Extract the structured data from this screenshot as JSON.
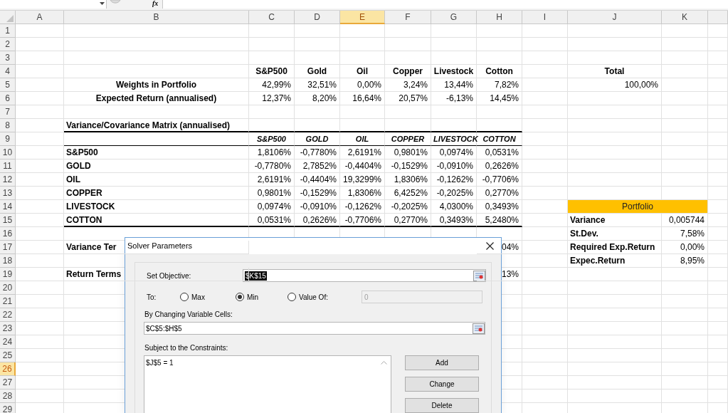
{
  "formula_bar": {
    "fx_label": "fx"
  },
  "columns": [
    {
      "label": "A",
      "selected": false
    },
    {
      "label": "B",
      "selected": false
    },
    {
      "label": "C",
      "selected": false
    },
    {
      "label": "D",
      "selected": false
    },
    {
      "label": "E",
      "selected": true
    },
    {
      "label": "F",
      "selected": false
    },
    {
      "label": "G",
      "selected": false
    },
    {
      "label": "H",
      "selected": false
    },
    {
      "label": "I",
      "selected": false
    },
    {
      "label": "J",
      "selected": false
    },
    {
      "label": "K",
      "selected": false
    }
  ],
  "rows": [
    {
      "label": "1",
      "selected": false
    },
    {
      "label": "2",
      "selected": false
    },
    {
      "label": "3",
      "selected": false
    },
    {
      "label": "4",
      "selected": false,
      "cells": {
        "C": {
          "text": "S&P500",
          "kind": "heading"
        },
        "D": {
          "text": "Gold",
          "kind": "heading"
        },
        "E": {
          "text": "Oil",
          "kind": "heading"
        },
        "F": {
          "text": "Copper",
          "kind": "heading"
        },
        "G": {
          "text": "Livestock",
          "kind": "heading"
        },
        "H": {
          "text": "Cotton",
          "kind": "heading"
        },
        "J": {
          "text": "Total",
          "kind": "heading"
        }
      }
    },
    {
      "label": "5",
      "selected": false,
      "cells": {
        "B": {
          "text": "Weights in Portfolio",
          "kind": "heading"
        },
        "C": {
          "text": "42,99%",
          "kind": "number"
        },
        "D": {
          "text": "32,51%",
          "kind": "number"
        },
        "E": {
          "text": "0,00%",
          "kind": "number"
        },
        "F": {
          "text": "3,24%",
          "kind": "number"
        },
        "G": {
          "text": "13,44%",
          "kind": "number"
        },
        "H": {
          "text": "7,82%",
          "kind": "number"
        },
        "J": {
          "text": "100,00%",
          "kind": "number"
        }
      }
    },
    {
      "label": "6",
      "selected": false,
      "cells": {
        "B": {
          "text": "Expected Return (annualised)",
          "kind": "heading"
        },
        "C": {
          "text": "12,37%",
          "kind": "number"
        },
        "D": {
          "text": "8,20%",
          "kind": "number"
        },
        "E": {
          "text": "16,64%",
          "kind": "number"
        },
        "F": {
          "text": "20,57%",
          "kind": "number"
        },
        "G": {
          "text": "-6,13%",
          "kind": "number"
        },
        "H": {
          "text": "14,45%",
          "kind": "number"
        }
      }
    },
    {
      "label": "7",
      "selected": false
    },
    {
      "label": "8",
      "selected": false,
      "rule_below": true,
      "rule_bold": true,
      "cells": {
        "B": {
          "text": "Variance/Covariance Matrix (annualised)",
          "kind": "label"
        }
      }
    },
    {
      "label": "9",
      "selected": false,
      "rule_below": true,
      "rule_bold": false,
      "cells": {
        "C": {
          "text": "S&P500",
          "kind": "matrixhead"
        },
        "D": {
          "text": "GOLD",
          "kind": "matrixhead"
        },
        "E": {
          "text": "OIL",
          "kind": "matrixhead"
        },
        "F": {
          "text": "COPPER",
          "kind": "matrixhead"
        },
        "G": {
          "text": "LIVESTOCK",
          "kind": "matrixhead"
        },
        "H": {
          "text": "COTTON",
          "kind": "matrixhead"
        }
      }
    },
    {
      "label": "10",
      "selected": false,
      "cells": {
        "B": {
          "text": "S&P500",
          "kind": "label"
        },
        "C": {
          "text": "1,8106%",
          "kind": "number"
        },
        "D": {
          "text": "-0,7780%",
          "kind": "number"
        },
        "E": {
          "text": "2,6191%",
          "kind": "number"
        },
        "F": {
          "text": "0,9801%",
          "kind": "number"
        },
        "G": {
          "text": "0,0974%",
          "kind": "number"
        },
        "H": {
          "text": "0,0531%",
          "kind": "number"
        }
      }
    },
    {
      "label": "11",
      "selected": false,
      "cells": {
        "B": {
          "text": "GOLD",
          "kind": "label"
        },
        "C": {
          "text": "-0,7780%",
          "kind": "number"
        },
        "D": {
          "text": "2,7852%",
          "kind": "number"
        },
        "E": {
          "text": "-0,4404%",
          "kind": "number"
        },
        "F": {
          "text": "-0,1529%",
          "kind": "number"
        },
        "G": {
          "text": "-0,0910%",
          "kind": "number"
        },
        "H": {
          "text": "0,2626%",
          "kind": "number"
        }
      }
    },
    {
      "label": "12",
      "selected": false,
      "cells": {
        "B": {
          "text": "OIL",
          "kind": "label"
        },
        "C": {
          "text": "2,6191%",
          "kind": "number"
        },
        "D": {
          "text": "-0,4404%",
          "kind": "number"
        },
        "E": {
          "text": "19,3299%",
          "kind": "number"
        },
        "F": {
          "text": "1,8306%",
          "kind": "number"
        },
        "G": {
          "text": "-0,1262%",
          "kind": "number"
        },
        "H": {
          "text": "-0,7706%",
          "kind": "number"
        }
      }
    },
    {
      "label": "13",
      "selected": false,
      "cells": {
        "B": {
          "text": "COPPER",
          "kind": "label"
        },
        "C": {
          "text": "0,9801%",
          "kind": "number"
        },
        "D": {
          "text": "-0,1529%",
          "kind": "number"
        },
        "E": {
          "text": "1,8306%",
          "kind": "number"
        },
        "F": {
          "text": "6,4252%",
          "kind": "number"
        },
        "G": {
          "text": "-0,2025%",
          "kind": "number"
        },
        "H": {
          "text": "0,2770%",
          "kind": "number"
        }
      }
    },
    {
      "label": "14",
      "selected": false,
      "cells": {
        "B": {
          "text": "LIVESTOCK",
          "kind": "label"
        },
        "C": {
          "text": "0,0974%",
          "kind": "number"
        },
        "D": {
          "text": "-0,0910%",
          "kind": "number"
        },
        "E": {
          "text": "-0,1262%",
          "kind": "number"
        },
        "F": {
          "text": "-0,2025%",
          "kind": "number"
        },
        "G": {
          "text": "4,0300%",
          "kind": "number"
        },
        "H": {
          "text": "0,3493%",
          "kind": "number"
        },
        "J": {
          "text": "Portfolio",
          "kind": "banner"
        }
      }
    },
    {
      "label": "15",
      "selected": false,
      "rule_below": true,
      "rule_bold": true,
      "cells": {
        "B": {
          "text": "COTTON",
          "kind": "label"
        },
        "C": {
          "text": "0,0531%",
          "kind": "number"
        },
        "D": {
          "text": "0,2626%",
          "kind": "number"
        },
        "E": {
          "text": "-0,7706%",
          "kind": "number"
        },
        "F": {
          "text": "0,2770%",
          "kind": "number"
        },
        "G": {
          "text": "0,3493%",
          "kind": "number"
        },
        "H": {
          "text": "5,2480%",
          "kind": "number"
        },
        "J": {
          "text": "Variance",
          "kind": "label"
        },
        "K": {
          "text": "0,005744",
          "kind": "number"
        }
      }
    },
    {
      "label": "16",
      "selected": false,
      "cells": {
        "J": {
          "text": "St.Dev.",
          "kind": "label"
        },
        "K": {
          "text": "7,58%",
          "kind": "number"
        }
      }
    },
    {
      "label": "17",
      "selected": false,
      "cells": {
        "B": {
          "text": "Variance Ter",
          "kind": "label"
        },
        "H": {
          "text": "04%",
          "kind": "number"
        },
        "J": {
          "text": "Required Exp.Return",
          "kind": "label"
        },
        "K": {
          "text": "0,00%",
          "kind": "number"
        }
      }
    },
    {
      "label": "18",
      "selected": false,
      "cells": {
        "J": {
          "text": "Expec.Return",
          "kind": "label"
        },
        "K": {
          "text": "8,95%",
          "kind": "number"
        }
      }
    },
    {
      "label": "19",
      "selected": false,
      "cells": {
        "B": {
          "text": "Return Terms",
          "kind": "label"
        },
        "H": {
          "text": "13%",
          "kind": "number"
        }
      }
    },
    {
      "label": "20",
      "selected": false
    },
    {
      "label": "21",
      "selected": false
    },
    {
      "label": "22",
      "selected": false
    },
    {
      "label": "23",
      "selected": false
    },
    {
      "label": "24",
      "selected": false
    },
    {
      "label": "25",
      "selected": false
    },
    {
      "label": "26",
      "selected": true
    },
    {
      "label": "27",
      "selected": false
    },
    {
      "label": "28",
      "selected": false
    },
    {
      "label": "29",
      "selected": false
    }
  ],
  "solver_dialog": {
    "title": "Solver Parameters",
    "objective": {
      "label": "Set Objective:",
      "value": "$K$15",
      "value_selected": true
    },
    "to": {
      "label": "To:",
      "options": [
        {
          "label": "Max",
          "selected": false
        },
        {
          "label": "Min",
          "selected": true
        },
        {
          "label": "Value Of:",
          "selected": false
        }
      ],
      "value_of": {
        "value": "0",
        "disabled": true
      }
    },
    "changing_cells": {
      "label": "By Changing Variable Cells:",
      "value": "$C$5:$H$5"
    },
    "constraints": {
      "label": "Subject to the Constraints:",
      "items": [
        "$J$5 = 1"
      ]
    },
    "buttons": [
      "Add",
      "Change",
      "Delete"
    ]
  }
}
